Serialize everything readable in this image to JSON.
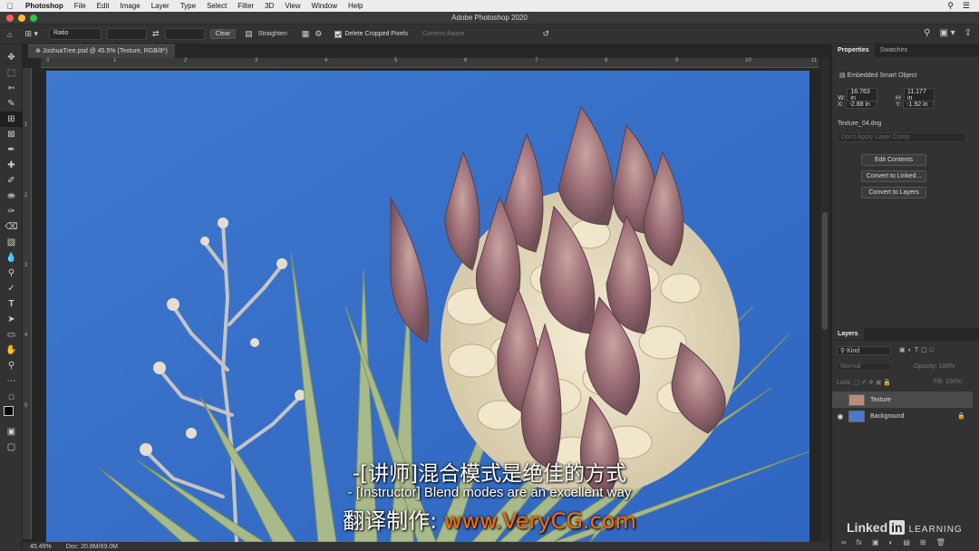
{
  "menubar": {
    "items": [
      "Photoshop",
      "File",
      "Edit",
      "Image",
      "Layer",
      "Type",
      "Select",
      "Filter",
      "3D",
      "View",
      "Window",
      "Help"
    ]
  },
  "window": {
    "title": "Adobe Photoshop 2020"
  },
  "options_bar": {
    "ratio_value": "Ratio",
    "clear_label": "Clear",
    "straighten_label": "Straighten",
    "delete_cropped_label": "Delete Cropped Pixels",
    "content_aware_label": "Content-Aware"
  },
  "document": {
    "tab_label": "JoshuaTree.psd @ 45.5% (Texture, RGB/8*)"
  },
  "ruler": {
    "h_ticks": [
      "0",
      "1",
      "2",
      "3",
      "4",
      "5",
      "6",
      "7",
      "8",
      "9",
      "10",
      "11"
    ],
    "v_ticks": [
      "1",
      "2",
      "3",
      "4",
      "5"
    ]
  },
  "status_bar": {
    "zoom": "45.49%",
    "doc_size": "Doc: 20.8M/69.0M"
  },
  "properties": {
    "tab_properties": "Properties",
    "tab_swatches": "Swatches",
    "object_type": "Embedded Smart Object",
    "w_label": "W:",
    "w_value": "16.763 in",
    "h_label": "H:",
    "h_value": "11.177 in",
    "x_label": "X:",
    "x_value": "-2.88 in",
    "y_label": "Y:",
    "y_value": "-1.92 in",
    "file_name": "Texture_04.dng",
    "layer_comp": "Don't Apply Layer Comp",
    "btn_edit": "Edit Contents",
    "btn_convert_linked": "Convert to Linked...",
    "btn_convert_layers": "Convert to Layers"
  },
  "layers": {
    "title": "Layers",
    "filter_kind": "Kind",
    "blend_mode": "Normal",
    "opacity_label": "Opacity:",
    "opacity_value": "100%",
    "lock_label": "Lock:",
    "fill_label": "Fill:",
    "fill_value": "100%",
    "items": [
      {
        "name": "Texture",
        "selected": true
      },
      {
        "name": "Background",
        "selected": false
      }
    ]
  },
  "subtitles": {
    "zh": "-[讲师]混合模式是绝佳的方式",
    "en": "- [Instructor] Blend modes are an excellent way",
    "credit_prefix": "翻译制作: ",
    "credit_url": "www.VeryCG.com"
  },
  "watermark": {
    "linked": "Linked",
    "in": "in",
    "learning": "LEARNING"
  },
  "colors": {
    "sky": "#3d72c7",
    "accent_orange": "#ff6b00",
    "panel_bg": "#323232"
  }
}
